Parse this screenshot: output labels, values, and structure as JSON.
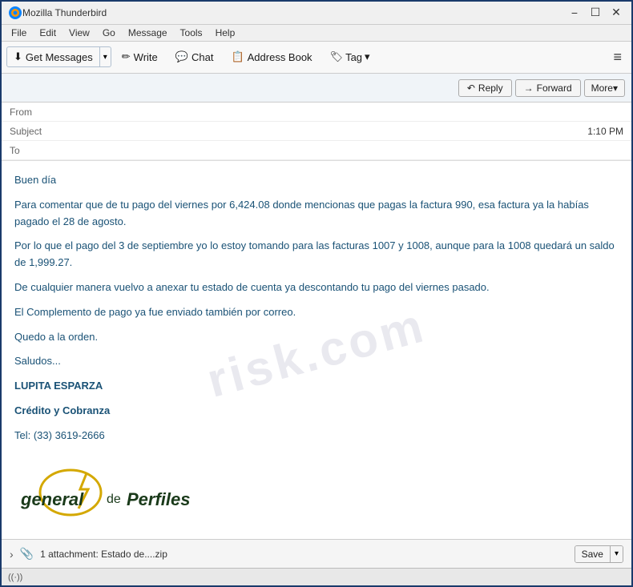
{
  "window": {
    "title": "Mozilla Thunderbird",
    "controls": {
      "minimize": "−",
      "maximize": "☐",
      "close": "✕"
    }
  },
  "menubar": {
    "items": [
      {
        "label": "File"
      },
      {
        "label": "Edit"
      },
      {
        "label": "View"
      },
      {
        "label": "Go"
      },
      {
        "label": "Message"
      },
      {
        "label": "Tools"
      },
      {
        "label": "Help"
      }
    ]
  },
  "toolbar": {
    "get_messages_label": "Get Messages",
    "write_label": "Write",
    "chat_label": "Chat",
    "address_book_label": "Address Book",
    "tag_label": "Tag"
  },
  "email_header_toolbar": {
    "reply_label": "Reply",
    "forward_label": "Forward",
    "more_label": "More"
  },
  "email_fields": {
    "from_label": "From",
    "from_value": "",
    "subject_label": "Subject",
    "time": "1:10 PM",
    "to_label": "To",
    "to_value": ""
  },
  "email_body": {
    "greeting": "Buen día",
    "para1": "Para comentar que de tu pago del viernes por  6,424.08 donde mencionas que pagas la factura 990, esa factura ya la habías pagado el 28 de agosto.",
    "para2": "Por lo que el pago del 3 de septiembre yo lo estoy tomando para las facturas 1007 y 1008, aunque para la 1008 quedará un saldo de 1,999.27.",
    "para3": "De cualquier manera vuelvo a anexar tu estado de cuenta ya descontando tu pago del viernes pasado.",
    "para4": "El Complemento de pago ya fue enviado también por correo.",
    "para5": "Quedo a la orden.",
    "para6": "Saludos...",
    "sender_name": "LUPITA ESPARZA",
    "sender_dept": "Crédito y Cobranza",
    "sender_tel_label": "Tel:",
    "sender_tel": "(33) 3619-2666",
    "company": "General de Perfiles"
  },
  "attachment": {
    "count": "1 attachment: Estado de....zip",
    "save_label": "Save"
  },
  "statusbar": {
    "signal_icon": "((·))"
  },
  "icons": {
    "reply_arrow": "↶",
    "forward_arrow": "→",
    "more_down": "▾",
    "pencil": "✏",
    "chat_bubble": "💬",
    "address_book": "📋",
    "tag": "🏷",
    "paperclip": "📎",
    "chevron_down": "▾",
    "chevron_right": "›",
    "hamburger": "≡"
  }
}
